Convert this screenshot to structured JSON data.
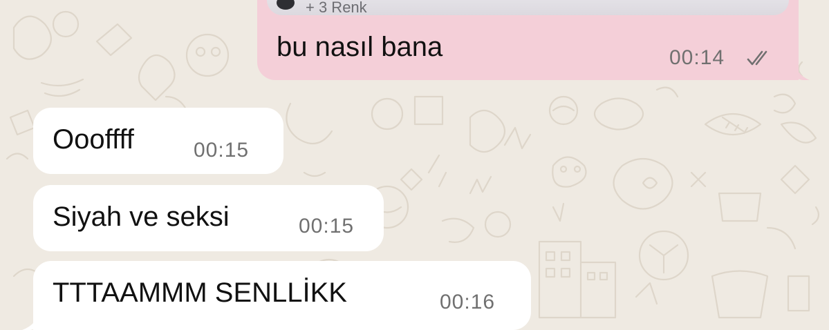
{
  "chat": {
    "outgoing": {
      "image_caption": "+ 3 Renk",
      "text": "bu nasıl bana",
      "time": "00:14",
      "status_icon": "double-check-icon",
      "bubble_color": "#f4cfd8"
    },
    "incoming": [
      {
        "text": "Oooffff",
        "time": "00:15"
      },
      {
        "text": "Siyah ve seksi",
        "time": "00:15"
      },
      {
        "text": "TTTAAMMM SENLLİKK",
        "time": "00:16"
      }
    ],
    "background_color": "#efeae2",
    "incoming_bubble_color": "#ffffff"
  }
}
